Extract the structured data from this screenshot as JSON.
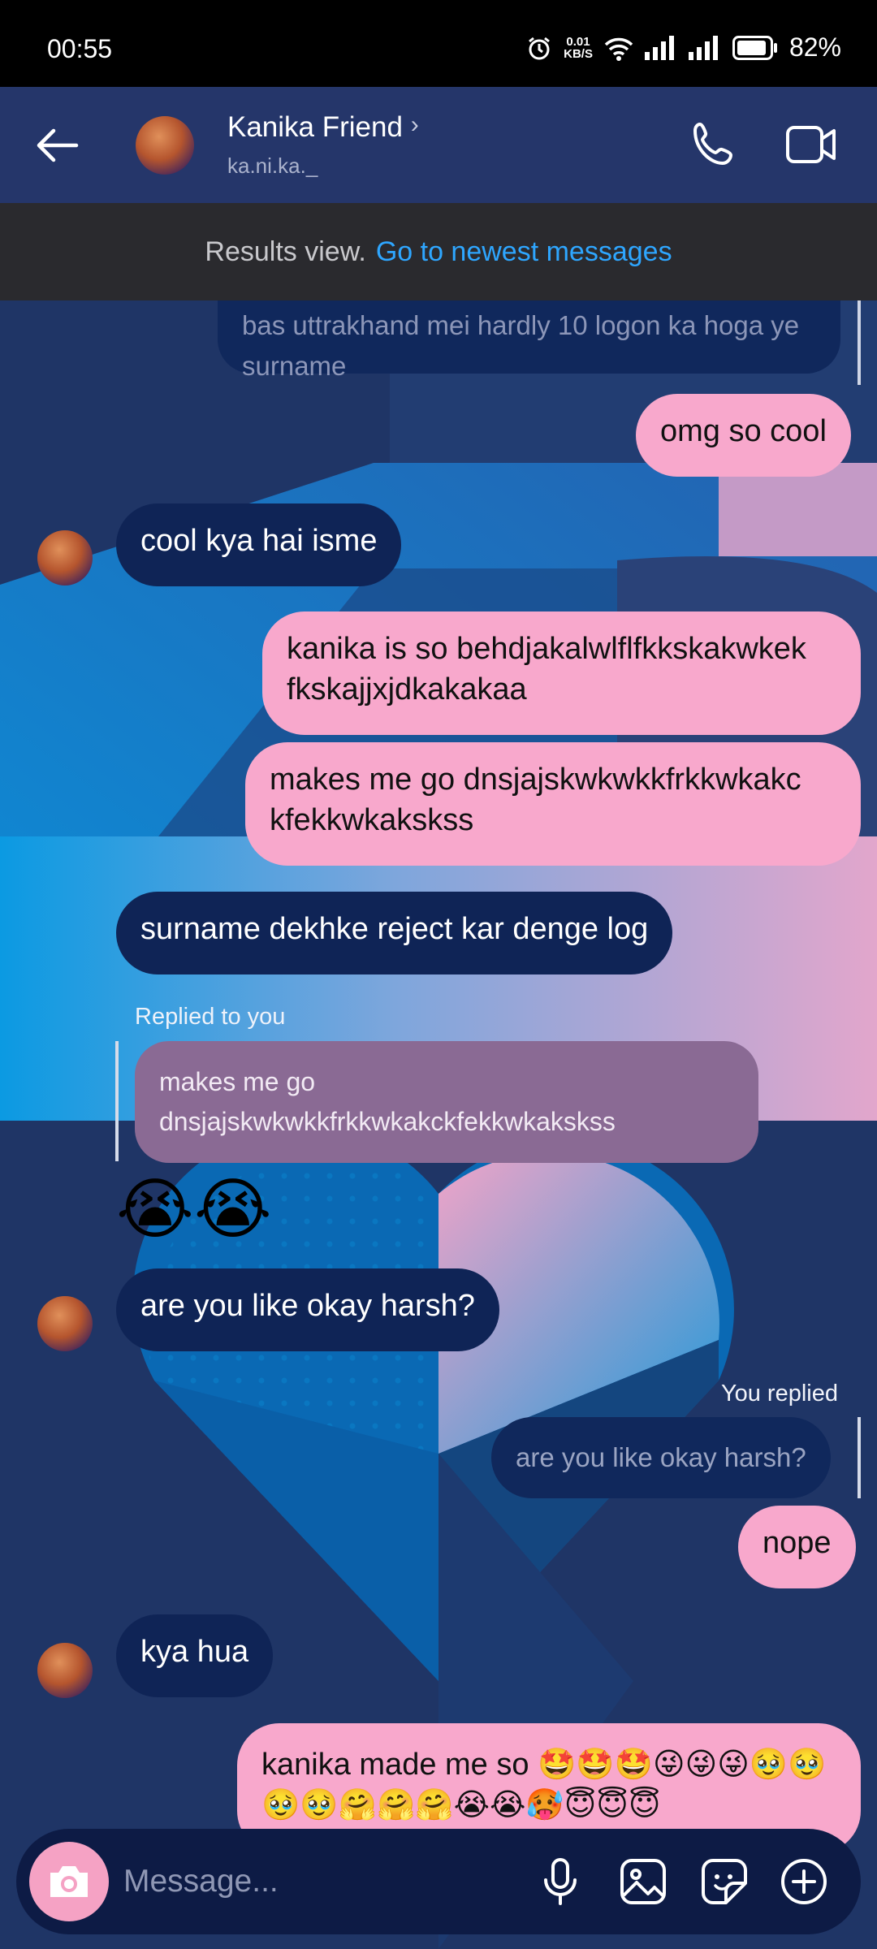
{
  "status_bar": {
    "time": "00:55",
    "net_speed_value": "0.01",
    "net_speed_unit": "KB/S",
    "battery": "82%"
  },
  "header": {
    "name": "Kanika Friend",
    "handle": "ka.ni.ka._"
  },
  "results_banner": {
    "text": "Results view.",
    "link": "Go to newest messages"
  },
  "messages": {
    "m1": "bas uttrakhand mei hardly 10 logon ka hoga ye surname",
    "m2": "omg so cool",
    "m3": "cool kya hai isme",
    "m4": "kanika is so behdjakalwlflfkkskakwkek fkskajjxjdkakakaa",
    "m5": "makes me go dnsjajskwkwkkfrkkwkakc kfekkwkakskss",
    "m6": "surname dekhke reject kar denge log",
    "reply_label_1": "Replied to you",
    "m7_quote": "makes me go dnsjajskwkwkkfrkkwkakckfekkwkakskss",
    "m7": "😭😭",
    "m8": "are you like okay harsh?",
    "reply_label_2": "You replied",
    "m9_quote": "are you like okay harsh?",
    "m9": "nope",
    "m10": "kya hua",
    "m11": "kanika made me so 🤩🤩🤩😜😜😜🥹🥹🥹🥹🤗🤗🤗😭😭🥵😇😇😇"
  },
  "composer": {
    "placeholder": "Message..."
  },
  "colors": {
    "incoming": "#0f2456",
    "outgoing": "#f8a8cc",
    "link": "#2ea6ff",
    "header": "#25366a"
  }
}
